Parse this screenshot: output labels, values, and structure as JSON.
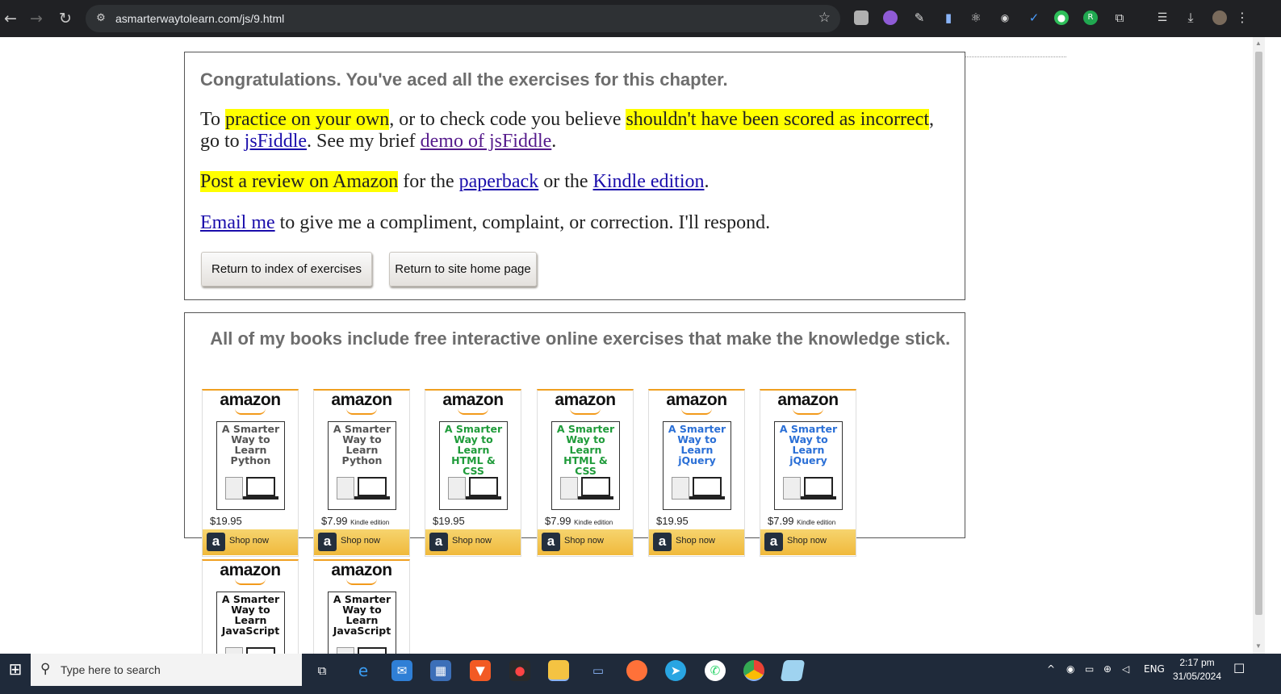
{
  "browser": {
    "url": "asmarterwaytolearn.com/js/9.html",
    "extensions": [
      "grey-square-ext",
      "purple-gradient-ext",
      "pen-ext",
      "document-ext",
      "atom-ext",
      "fox-ext",
      "blue-check-ext",
      "green-robot-ext",
      "green-r-ext",
      "puzzle-ext",
      "playlist-ext",
      "download-ext",
      "profile-avatar",
      "menu-ext"
    ]
  },
  "panel1": {
    "heading": "Congratulations. You've aced all the exercises for this chapter.",
    "p1": {
      "t1": "To ",
      "hl1": "practice on your own",
      "t2": ", or to check code you believe ",
      "hl2": "shouldn't have been scored as incorrect",
      "t3": ", go to ",
      "link1": "jsFiddle",
      "t4": ". See my brief ",
      "link2": "demo of jsFiddle",
      "t5": "."
    },
    "p2": {
      "hl": "Post a review on Amazon",
      "t1": " for the ",
      "link1": "paperback",
      "t2": " or the ",
      "link2": "Kindle edition",
      "t3": "."
    },
    "p3": {
      "link": "Email me",
      "t": " to give me a compliment, complaint, or correction. I'll respond."
    },
    "buttons": {
      "index": "Return to index of exercises",
      "home": "Return to site home page"
    }
  },
  "panel2": {
    "heading": "All of my books include free interactive online exercises that make the knowledge stick."
  },
  "books": [
    {
      "brand": "amazon",
      "title": "A Smarter Way to Learn Python",
      "price": "$19.95",
      "note": "",
      "shop": "Shop now",
      "color": "#555555"
    },
    {
      "brand": "amazon",
      "title": "A Smarter Way to Learn Python",
      "price": "$7.99",
      "note": "Kindle edition",
      "shop": "Shop now",
      "color": "#555555"
    },
    {
      "brand": "amazon",
      "title": "A Smarter Way to Learn HTML & CSS",
      "price": "$19.95",
      "note": "",
      "shop": "Shop now",
      "color": "#1f9b3a"
    },
    {
      "brand": "amazon",
      "title": "A Smarter Way to Learn HTML & CSS",
      "price": "$7.99",
      "note": "Kindle edition",
      "shop": "Shop now",
      "color": "#1f9b3a"
    },
    {
      "brand": "amazon",
      "title": "A Smarter Way to Learn jQuery",
      "price": "$19.95",
      "note": "",
      "shop": "Shop now",
      "color": "#2a6fd6"
    },
    {
      "brand": "amazon",
      "title": "A Smarter Way to Learn jQuery",
      "price": "$7.99",
      "note": "Kindle edition",
      "shop": "Shop now",
      "color": "#2a6fd6"
    },
    {
      "brand": "amazon",
      "title": "A Smarter Way to Learn JavaScript",
      "price": "",
      "note": "",
      "shop": "",
      "color": "#111111"
    },
    {
      "brand": "amazon",
      "title": "A Smarter Way to Learn JavaScript",
      "price": "",
      "note": "",
      "shop": "",
      "color": "#111111"
    }
  ],
  "taskbar": {
    "search_placeholder": "Type here to search",
    "lang": "ENG",
    "time": "2:17 pm",
    "date": "31/05/2024",
    "apps": [
      "task-view",
      "edge",
      "mail",
      "store",
      "brave",
      "recorder",
      "file-explorer",
      "remote-desktop",
      "firefox",
      "telegram",
      "whatsapp",
      "chrome",
      "notepad"
    ]
  }
}
